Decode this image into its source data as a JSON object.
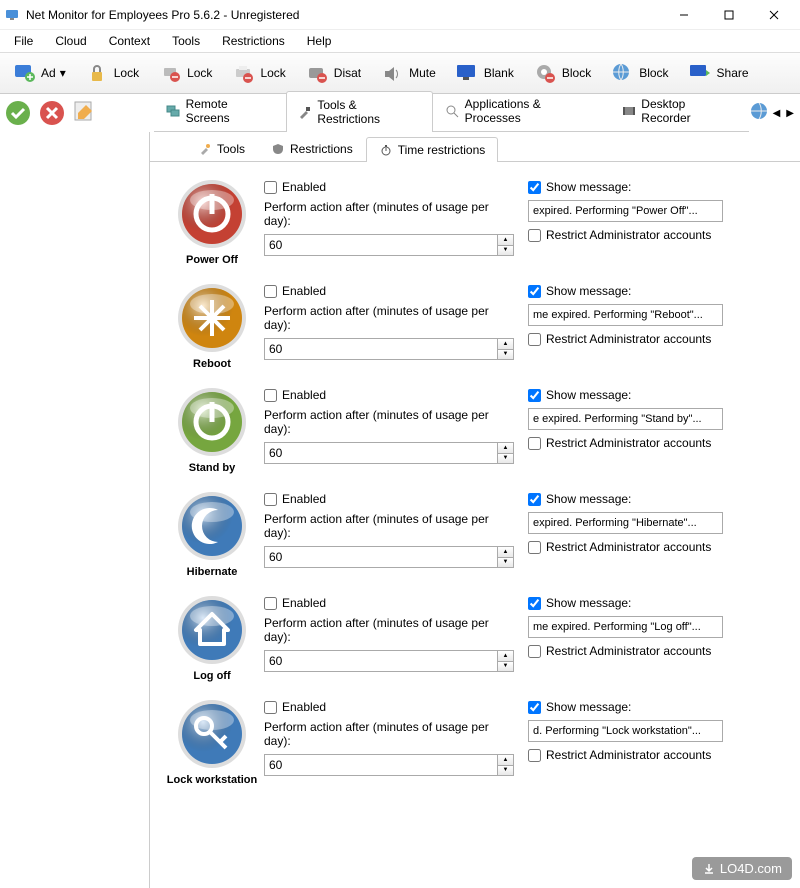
{
  "window": {
    "title": "Net Monitor for Employees Pro 5.6.2 - Unregistered"
  },
  "menubar": [
    "File",
    "Cloud",
    "Context",
    "Tools",
    "Restrictions",
    "Help"
  ],
  "toolbar": [
    {
      "label": "Ad",
      "icon": "monitor-add"
    },
    {
      "label": "Lock",
      "icon": "padlock"
    },
    {
      "label": "Lock",
      "icon": "usb-block"
    },
    {
      "label": "Lock",
      "icon": "printer-block"
    },
    {
      "label": "Disat",
      "icon": "ctrlalt"
    },
    {
      "label": "Mute",
      "icon": "speaker"
    },
    {
      "label": "Blank",
      "icon": "monitor"
    },
    {
      "label": "Block",
      "icon": "gear-block"
    },
    {
      "label": "Block",
      "icon": "globe-block"
    },
    {
      "label": "Share",
      "icon": "monitor-share"
    }
  ],
  "top_tabs": [
    {
      "label": "Remote Screens",
      "icon": "screens",
      "active": false
    },
    {
      "label": "Tools & Restrictions",
      "icon": "hammer",
      "active": true
    },
    {
      "label": "Applications & Processes",
      "icon": "search",
      "active": false
    },
    {
      "label": "Desktop Recorder",
      "icon": "film",
      "active": false
    }
  ],
  "sub_tabs": [
    {
      "label": "Tools",
      "icon": "wrench",
      "active": false
    },
    {
      "label": "Restrictions",
      "icon": "shield",
      "active": false
    },
    {
      "label": "Time restrictions",
      "icon": "stopwatch",
      "active": true
    }
  ],
  "form_labels": {
    "enabled": "Enabled",
    "perform": "Perform action after (minutes of usage per day):",
    "show_message": "Show message:",
    "restrict_admin": "Restrict Administrator accounts"
  },
  "restrictions": [
    {
      "name": "Power Off",
      "icon": "power-red",
      "enabled": false,
      "minutes": "60",
      "show_msg": true,
      "msg": "expired. Performing \"Power Off\"...",
      "restrict_admin": false
    },
    {
      "name": "Reboot",
      "icon": "reboot-orange",
      "enabled": false,
      "minutes": "60",
      "show_msg": true,
      "msg": "me expired. Performing \"Reboot\"...",
      "restrict_admin": false
    },
    {
      "name": "Stand by",
      "icon": "power-green",
      "enabled": false,
      "minutes": "60",
      "show_msg": true,
      "msg": "e expired. Performing \"Stand by\"...",
      "restrict_admin": false
    },
    {
      "name": "Hibernate",
      "icon": "moon-blue",
      "enabled": false,
      "minutes": "60",
      "show_msg": true,
      "msg": "expired. Performing \"Hibernate\"...",
      "restrict_admin": false
    },
    {
      "name": "Log off",
      "icon": "home-blue",
      "enabled": false,
      "minutes": "60",
      "show_msg": true,
      "msg": "me expired. Performing \"Log off\"...",
      "restrict_admin": false
    },
    {
      "name": "Lock workstation",
      "icon": "key-blue",
      "enabled": false,
      "minutes": "60",
      "show_msg": true,
      "msg": "d. Performing \"Lock workstation\"...",
      "restrict_admin": false
    }
  ],
  "watermark": "LO4D.com"
}
